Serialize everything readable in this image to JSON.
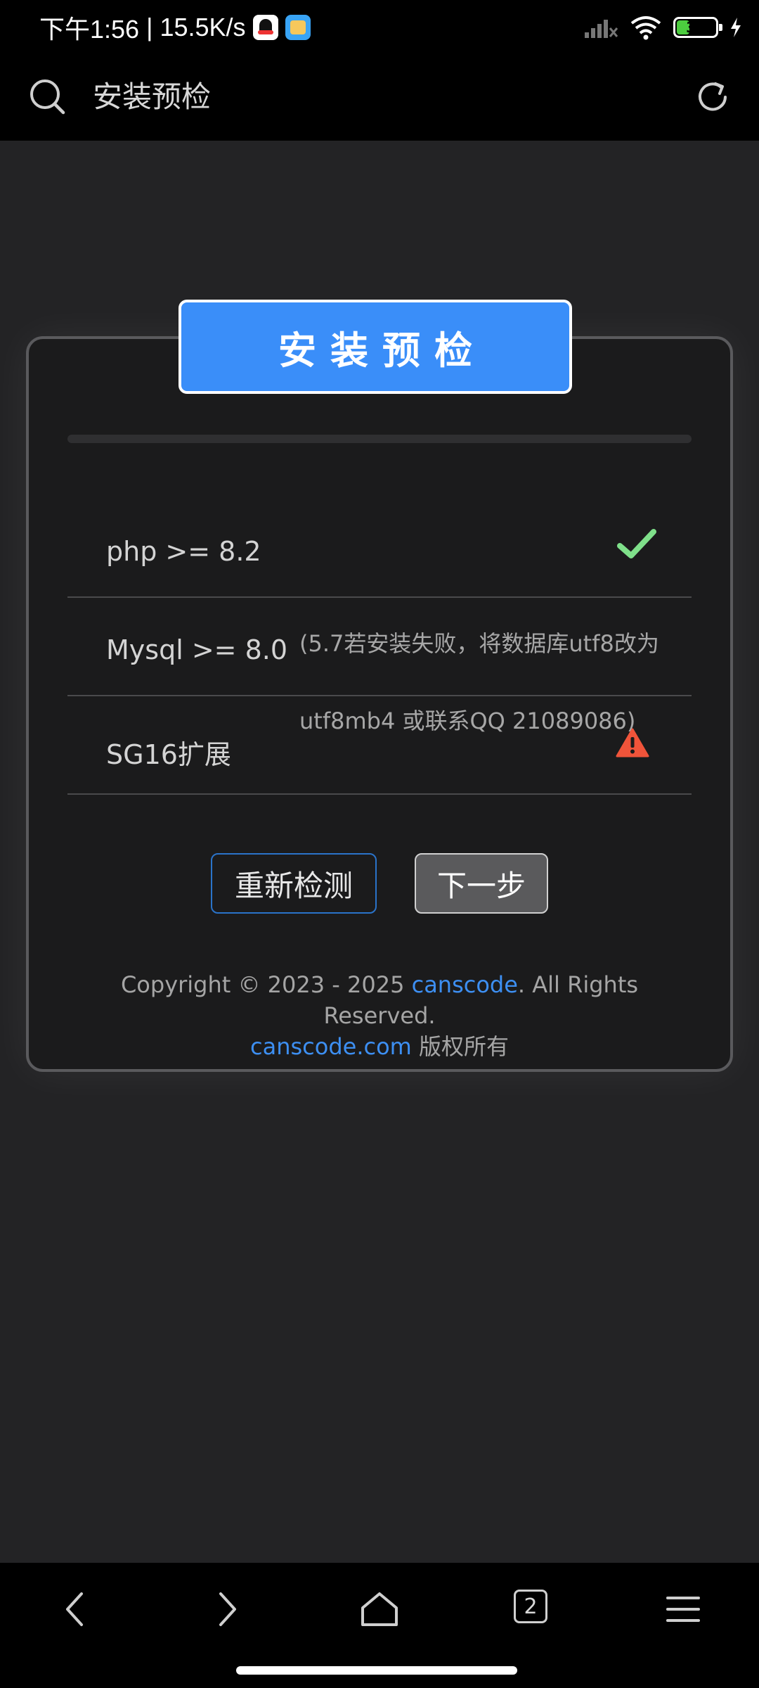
{
  "status_bar": {
    "time": "下午1:56",
    "separator": "|",
    "speed": "15.5K/s",
    "battery": "34",
    "battery_level_percent": 34
  },
  "top_bar": {
    "title": "安装预检"
  },
  "card": {
    "header": "安装预检",
    "checks": [
      {
        "label": "php >= 8.2",
        "status_icon": "check-icon"
      },
      {
        "label": "Mysql >= 8.0",
        "note": "(5.7若安装失败，将数据库utf8改为"
      },
      {
        "label": "SG16扩展",
        "note": "utf8mb4 或联系QQ 21089086)",
        "status_icon": "warning-icon"
      }
    ],
    "buttons": {
      "recheck": "重新检测",
      "next": "下一步"
    },
    "footer": {
      "line1_prefix": "Copyright © 2023 - 2025 ",
      "line1_link": "canscode",
      "line1_suffix": ". All Rights Reserved.",
      "line2_link": "canscode.com",
      "line2_suffix": " 版权所有"
    }
  },
  "bottom_nav": {
    "tab_count": "2"
  },
  "colors": {
    "accent": "#3a8ef9",
    "link": "#3d8ff2",
    "success": "#7fe08a",
    "warning": "#f0543a"
  }
}
